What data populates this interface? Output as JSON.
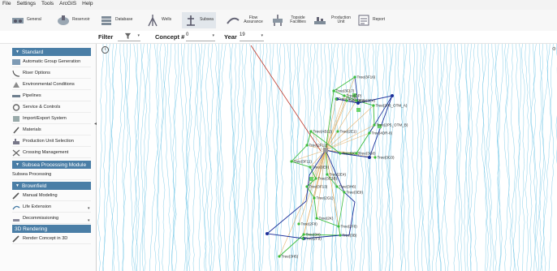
{
  "menu": [
    "File",
    "Settings",
    "Tools",
    "ArcGIS",
    "Help"
  ],
  "ribbon": [
    {
      "label": "General",
      "icon": "general-icon"
    },
    {
      "label": "Reservoir",
      "icon": "reservoir-icon"
    },
    {
      "label": "Database",
      "icon": "database-icon"
    },
    {
      "label": "Wells",
      "icon": "wells-icon"
    },
    {
      "label": "Subsea",
      "icon": "subsea-icon"
    },
    {
      "label": "Flow Assurance",
      "icon": "flow-assurance-icon"
    },
    {
      "label": "Topside Facilities",
      "icon": "topside-icon"
    },
    {
      "label": "Production Unit",
      "icon": "production-unit-icon"
    },
    {
      "label": "Report",
      "icon": "report-icon"
    }
  ],
  "filter": {
    "filter_label": "Filter",
    "concept_label": "Concept #",
    "concept_value": "0",
    "year_label": "Year",
    "year_value": "19"
  },
  "sections": {
    "standard": "Standard",
    "subsea_module": "Subsea Processing Module",
    "brownfield": "Brownfield",
    "rendering": "3D Rendering"
  },
  "standard_items": [
    "Automatic Group Generation",
    "Riser Options",
    "Environmental Conditions",
    "Pipelines",
    "Service & Controls",
    "Import/Export System",
    "Materials",
    "Production Unit Selection",
    "Crossing Management"
  ],
  "subsea_items": [
    "Subsea Processing"
  ],
  "brownfield_items": [
    "Manual Modeling",
    "Life Extension",
    "Decommissioning"
  ],
  "rendering_items": [
    "Render Concept in 3D"
  ],
  "map": {
    "trees": [
      "Tree(3F16)",
      "Tree(3F17)",
      "Tree(3F18)",
      "Tree(DP)",
      "Tree(3E3)",
      "Tree(3E4)",
      "Tree(2P6_OTM_A)",
      "Tree(2P5_OTM_B)",
      "Tree(4DR-8)",
      "Tree(AB12)",
      "Tree(2E1)",
      "Tree(2F12)",
      "Tree(3F11)",
      "Tree(3E9)",
      "Tree(2G2)",
      "Tree(3G8)",
      "Tree(3G3)",
      "Tree(2E4)",
      "Tree(3E3B)",
      "Tree(3F13)",
      "Tree(3H6)",
      "Tree(3E8)",
      "Tree(2G1)",
      "Tree(2K)",
      "Tree(2F6)",
      "Tree(2F8)",
      "Tree(3H)",
      "Tree(3B)",
      "Tree(2F9)",
      "Tree(3H5)"
    ]
  },
  "colors": {
    "section": "#4a7ea6",
    "bathymetry": "#5fbfe3",
    "flowline_blue": "#1c2f9a",
    "flowline_green": "#3dbd3d",
    "umbilical": "#e0a85a",
    "riser": "#c0392b"
  }
}
